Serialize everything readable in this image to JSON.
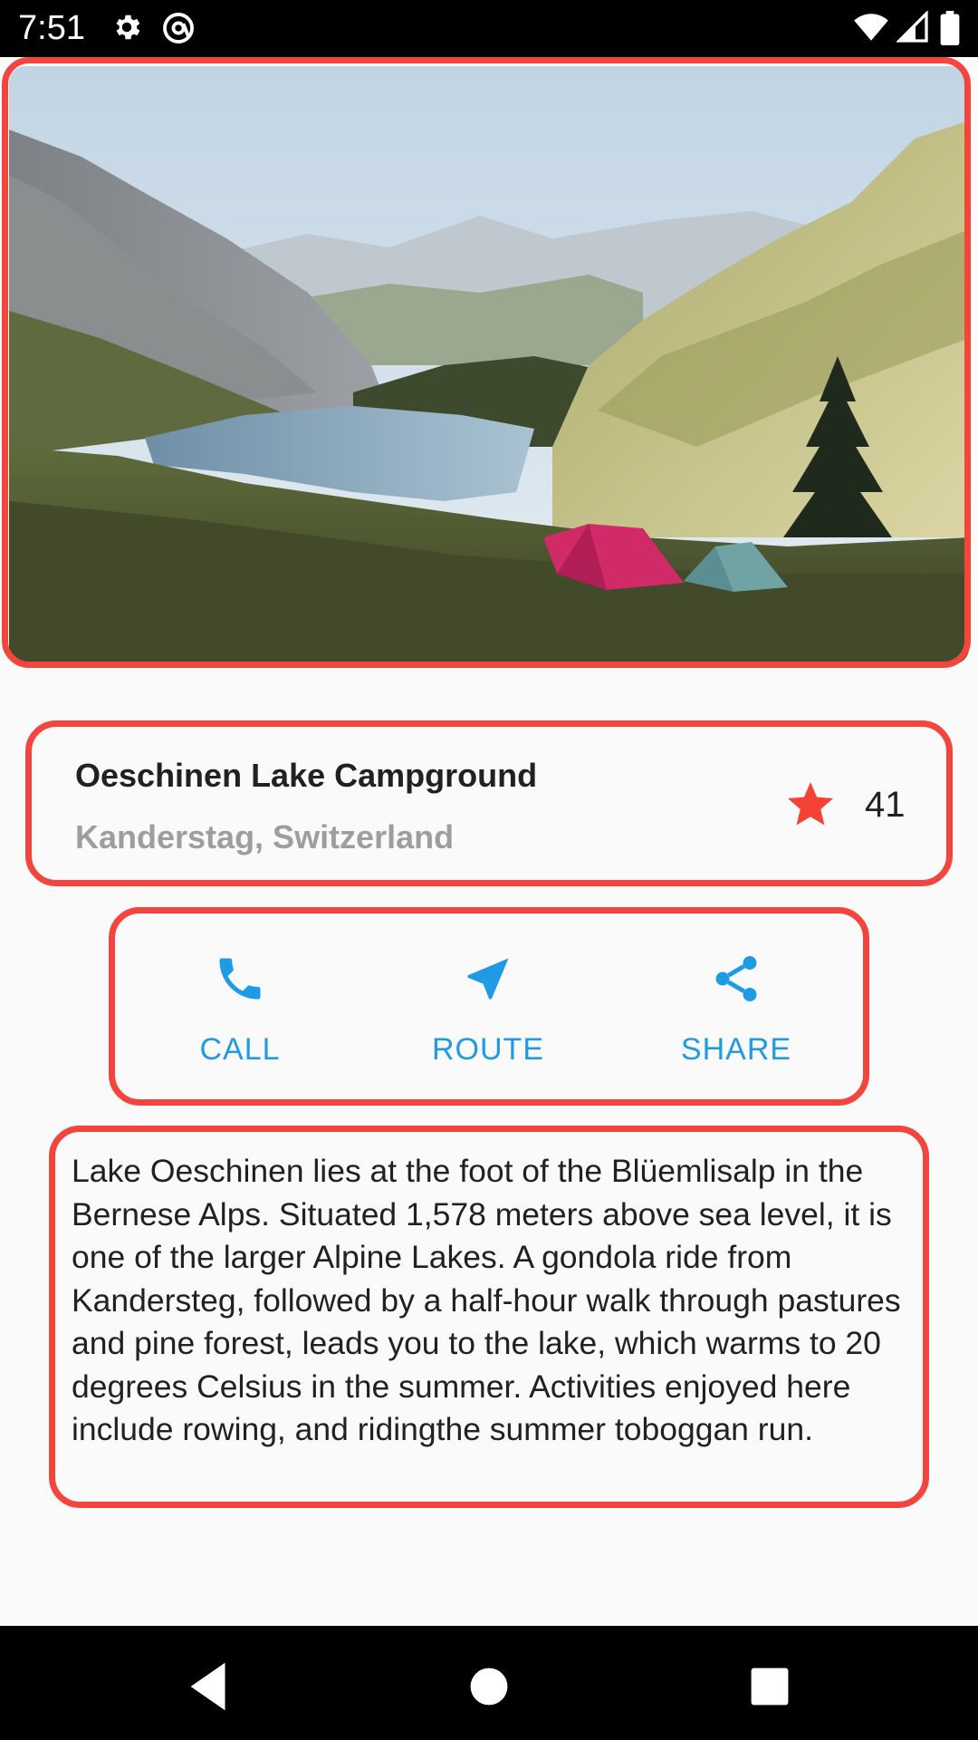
{
  "status_bar": {
    "time": "7:51",
    "left_icons": [
      "gear-icon",
      "at-sign-icon"
    ],
    "right_icons": [
      "wifi-icon",
      "cellular-signal-icon",
      "battery-icon"
    ]
  },
  "hero_image": {
    "alt": "Oeschinen Lake with camping tents"
  },
  "place": {
    "title": "Oeschinen Lake Campground",
    "location": "Kanderstag, Switzerland",
    "favorite_count": "41",
    "favorite_icon": "star-icon",
    "accent_color": "#f44336"
  },
  "actions": [
    {
      "label": "CALL",
      "icon": "phone-icon"
    },
    {
      "label": "ROUTE",
      "icon": "navigation-arrow-icon"
    },
    {
      "label": "SHARE",
      "icon": "share-icon"
    }
  ],
  "action_color": "#1e9be4",
  "description": "Lake Oeschinen lies at the foot of the Blüemlisalp in the Bernese Alps. Situated 1,578 meters above sea level, it is one of the larger Alpine Lakes. A gondola ride from Kandersteg, followed by a half-hour walk through pastures and pine forest, leads you to the lake, which warms to 20 degrees Celsius in the summer. Activities enjoyed here include rowing, and ridingthe summer toboggan run.",
  "nav_bar": {
    "buttons": [
      "back-triangle-icon",
      "home-circle-icon",
      "recents-square-icon"
    ]
  }
}
